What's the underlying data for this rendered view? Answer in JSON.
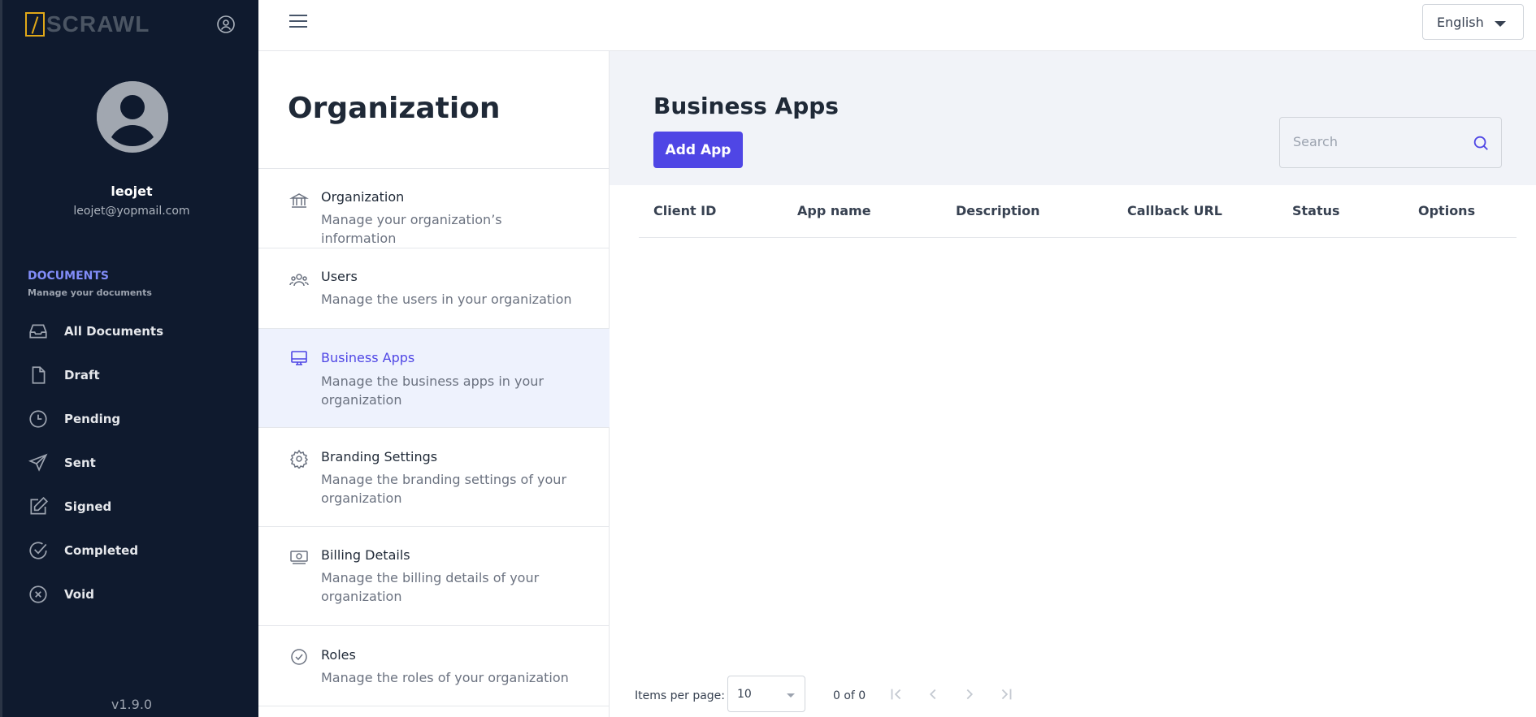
{
  "app": {
    "logo_text": "SCRAWL",
    "version": "v1.9.0"
  },
  "user": {
    "name": "leojet",
    "email": "leojet@yopmail.com"
  },
  "sidebar": {
    "section_title": "DOCUMENTS",
    "section_subtitle": "Manage your documents",
    "items": [
      {
        "label": "All Documents",
        "icon": "inbox-icon"
      },
      {
        "label": "Draft",
        "icon": "file-icon"
      },
      {
        "label": "Pending",
        "icon": "clock-icon"
      },
      {
        "label": "Sent",
        "icon": "send-icon"
      },
      {
        "label": "Signed",
        "icon": "edit-icon"
      },
      {
        "label": "Completed",
        "icon": "check-circle-icon"
      },
      {
        "label": "Void",
        "icon": "x-circle-icon"
      }
    ]
  },
  "topbar": {
    "language": "English"
  },
  "org_menu": {
    "title": "Organization",
    "items": [
      {
        "label": "Organization",
        "description": "Manage your organization’s information",
        "icon": "bank-icon"
      },
      {
        "label": "Users",
        "description": "Manage the users in your organization",
        "icon": "users-icon"
      },
      {
        "label": "Business Apps",
        "description": "Manage the business apps in your organization",
        "icon": "monitor-icon"
      },
      {
        "label": "Branding Settings",
        "description": "Manage the branding settings of your organization",
        "icon": "gear-icon"
      },
      {
        "label": "Billing Details",
        "description": "Manage the billing details of your organization",
        "icon": "banknote-icon"
      },
      {
        "label": "Roles",
        "description": "Manage the roles of your organization",
        "icon": "badge-check-icon"
      }
    ]
  },
  "main": {
    "title": "Business Apps",
    "add_button": "Add App",
    "search_placeholder": "Search",
    "columns": [
      "Client ID",
      "App name",
      "Description",
      "Callback URL",
      "Status",
      "Options"
    ]
  },
  "pager": {
    "items_per_page_label": "Items per page:",
    "page_size": "10",
    "range": "0 of 0"
  },
  "colors": {
    "sidebar_bg": "#0f1a2e",
    "accent": "#4f46e5",
    "active_bg": "#eef2fd"
  }
}
